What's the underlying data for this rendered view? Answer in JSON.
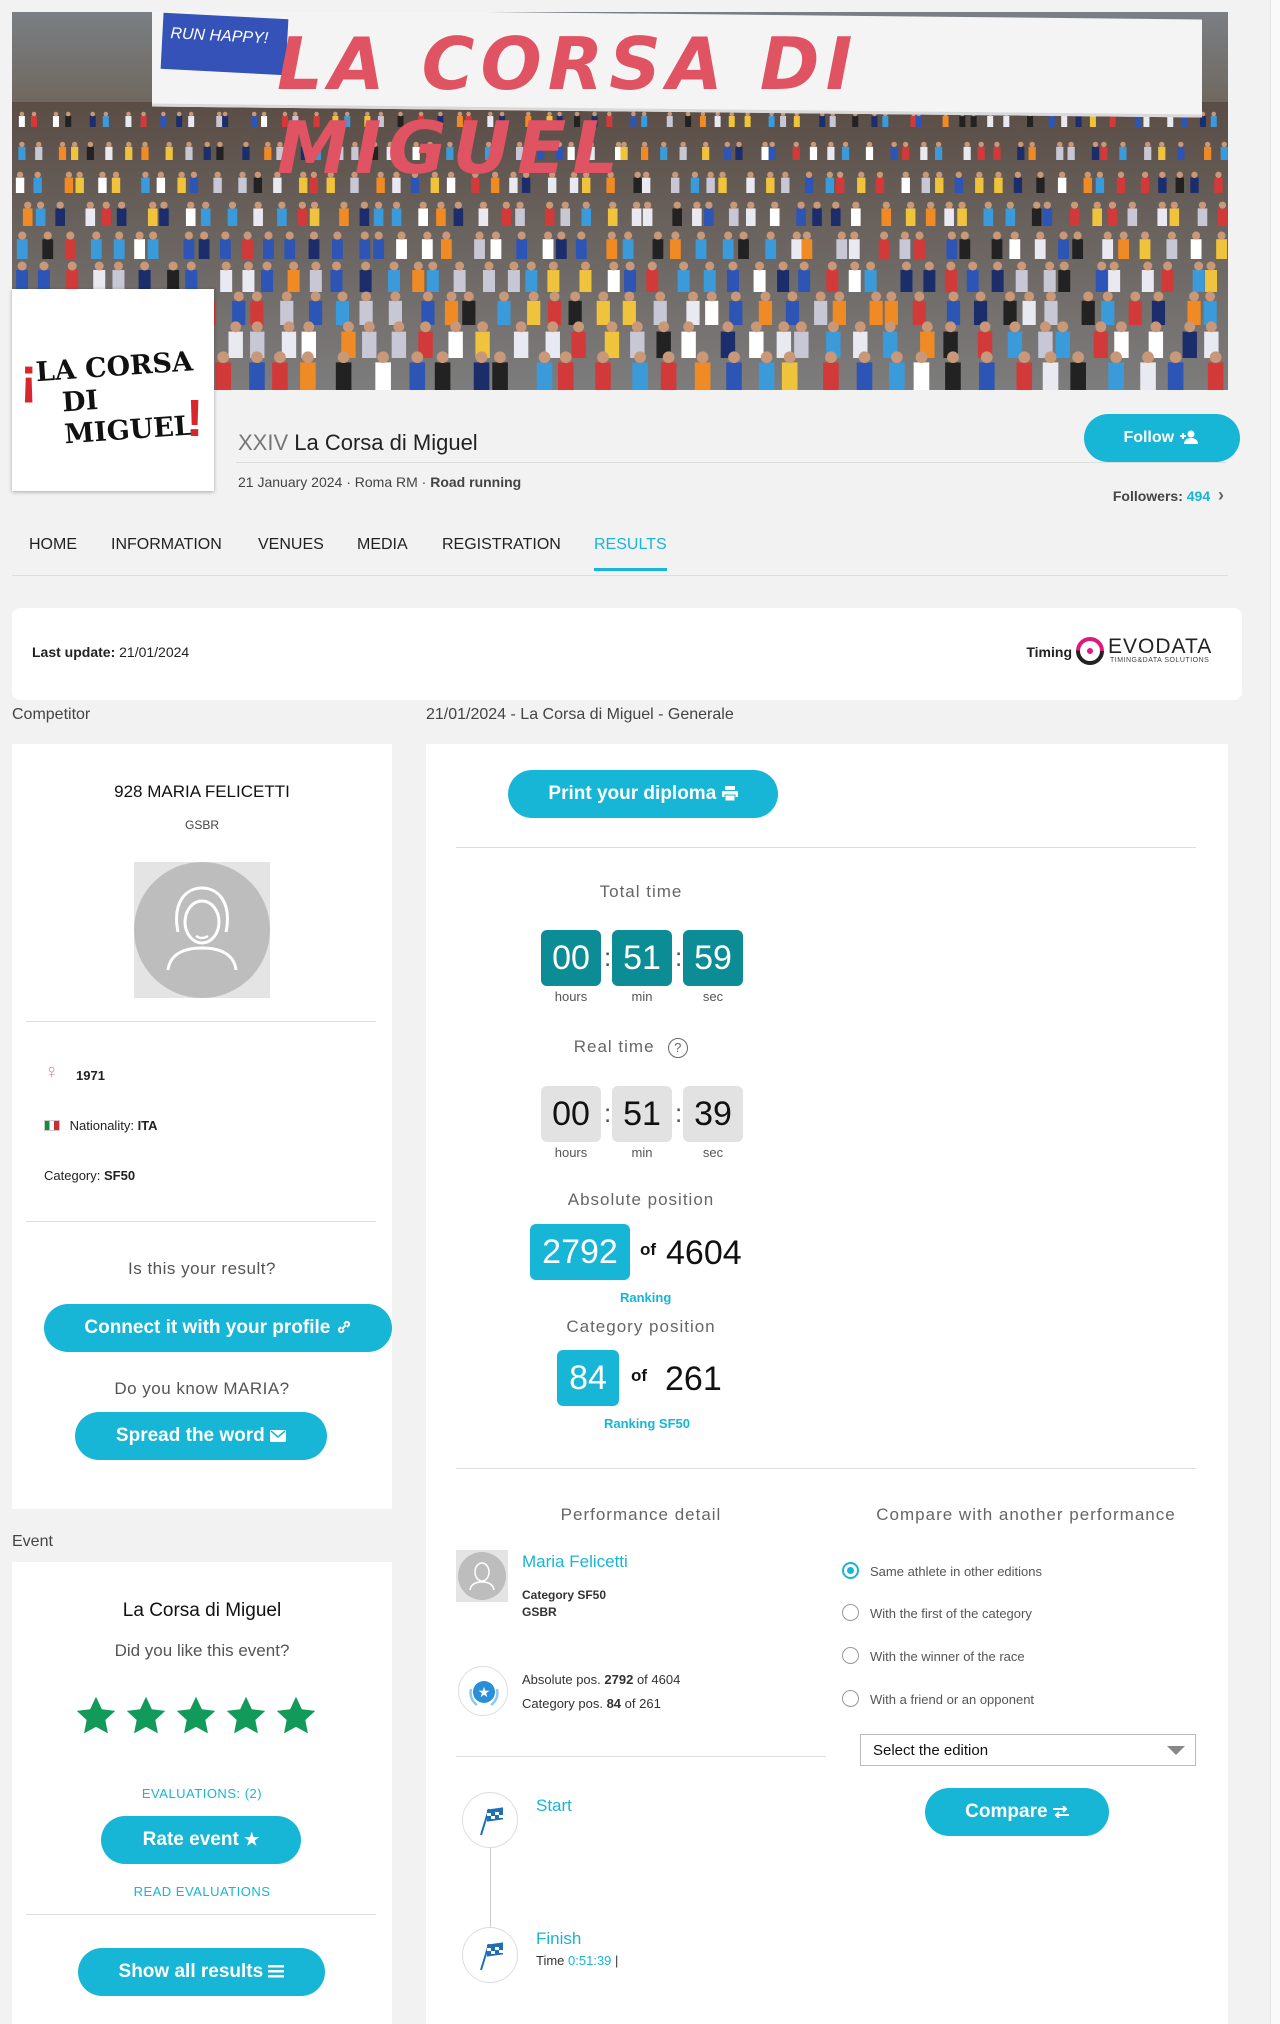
{
  "hero": {
    "banner_small": "RUN HAPPY!",
    "banner_text": "LA CORSA DI MIGUEL",
    "logo_line1": "LA CORSA",
    "logo_line2": "DI MIGUEL"
  },
  "event": {
    "edition": "XXIV",
    "name": "La Corsa di Miguel",
    "date": "21 January 2024",
    "location": "Roma RM",
    "type": "Road running",
    "follow_label": "Follow",
    "followers_label": "Followers:",
    "followers_count": "494"
  },
  "tabs": [
    {
      "label": "HOME"
    },
    {
      "label": "INFORMATION"
    },
    {
      "label": "VENUES"
    },
    {
      "label": "MEDIA"
    },
    {
      "label": "REGISTRATION"
    },
    {
      "label": "RESULTS",
      "active": true
    }
  ],
  "update": {
    "label": "Last update:",
    "date": "21/01/2024",
    "timing_label": "Timing",
    "timing_brand": "EVODATA",
    "timing_tagline": "TIMING&DATA SOLUTIONS"
  },
  "sections": {
    "competitor": "Competitor",
    "event": "Event",
    "results_header": "21/01/2024 - La Corsa di Miguel - Generale"
  },
  "competitor": {
    "bib_name": "928 MARIA FELICETTI",
    "club": "GSBR",
    "birth_year": "1971",
    "nationality_label": "Nationality:",
    "nationality": "ITA",
    "category_label": "Category:",
    "category": "SF50",
    "question": "Is this your result?",
    "connect_label": "Connect it with your profile",
    "know_question": "Do you know MARIA?",
    "spread_label": "Spread the word"
  },
  "event_card": {
    "name": "La Corsa di Miguel",
    "question": "Did you like this event?",
    "rating": 5,
    "evaluations": "EVALUATIONS: (2)",
    "rate_label": "Rate event",
    "read_evaluations": "READ EVALUATIONS",
    "show_results": "Show all results"
  },
  "results": {
    "diploma_label": "Print your diploma",
    "total_time_label": "Total time",
    "total_time": {
      "hours": "00",
      "min": "51",
      "sec": "59"
    },
    "real_time_label": "Real time",
    "real_time": {
      "hours": "00",
      "min": "51",
      "sec": "39"
    },
    "unit_hours": "hours",
    "unit_min": "min",
    "unit_sec": "sec",
    "absolute_label": "Absolute position",
    "absolute_pos": "2792",
    "of": "of",
    "absolute_total": "4604",
    "ranking_link": "Ranking",
    "category_label": "Category position",
    "category_pos": "84",
    "category_total": "261",
    "ranking_cat_link": "Ranking SF50"
  },
  "performance": {
    "title": "Performance detail",
    "athlete": "Maria Felicetti",
    "category_line": "Category SF50",
    "club": "GSBR",
    "abs_label": "Absolute pos.",
    "abs_pos": "2792",
    "abs_of": "of 4604",
    "cat_label": "Category pos.",
    "cat_pos": "84",
    "cat_of": "of 261",
    "start_label": "Start",
    "finish_label": "Finish",
    "time_label": "Time",
    "finish_time": "0:51:39"
  },
  "compare": {
    "title": "Compare with another performance",
    "options": [
      {
        "label": "Same athlete in other editions",
        "selected": true
      },
      {
        "label": "With the first of the category",
        "selected": false
      },
      {
        "label": "With the winner of the race",
        "selected": false
      },
      {
        "label": "With a friend or an opponent",
        "selected": false
      }
    ],
    "select_placeholder": "Select the edition",
    "compare_label": "Compare"
  },
  "colors": {
    "accent": "#17b5d6",
    "time_dark": "#0c8c95",
    "star_green": "#129a5a",
    "logo_red": "#d9262e",
    "evodata_pink": "#e0177c"
  }
}
